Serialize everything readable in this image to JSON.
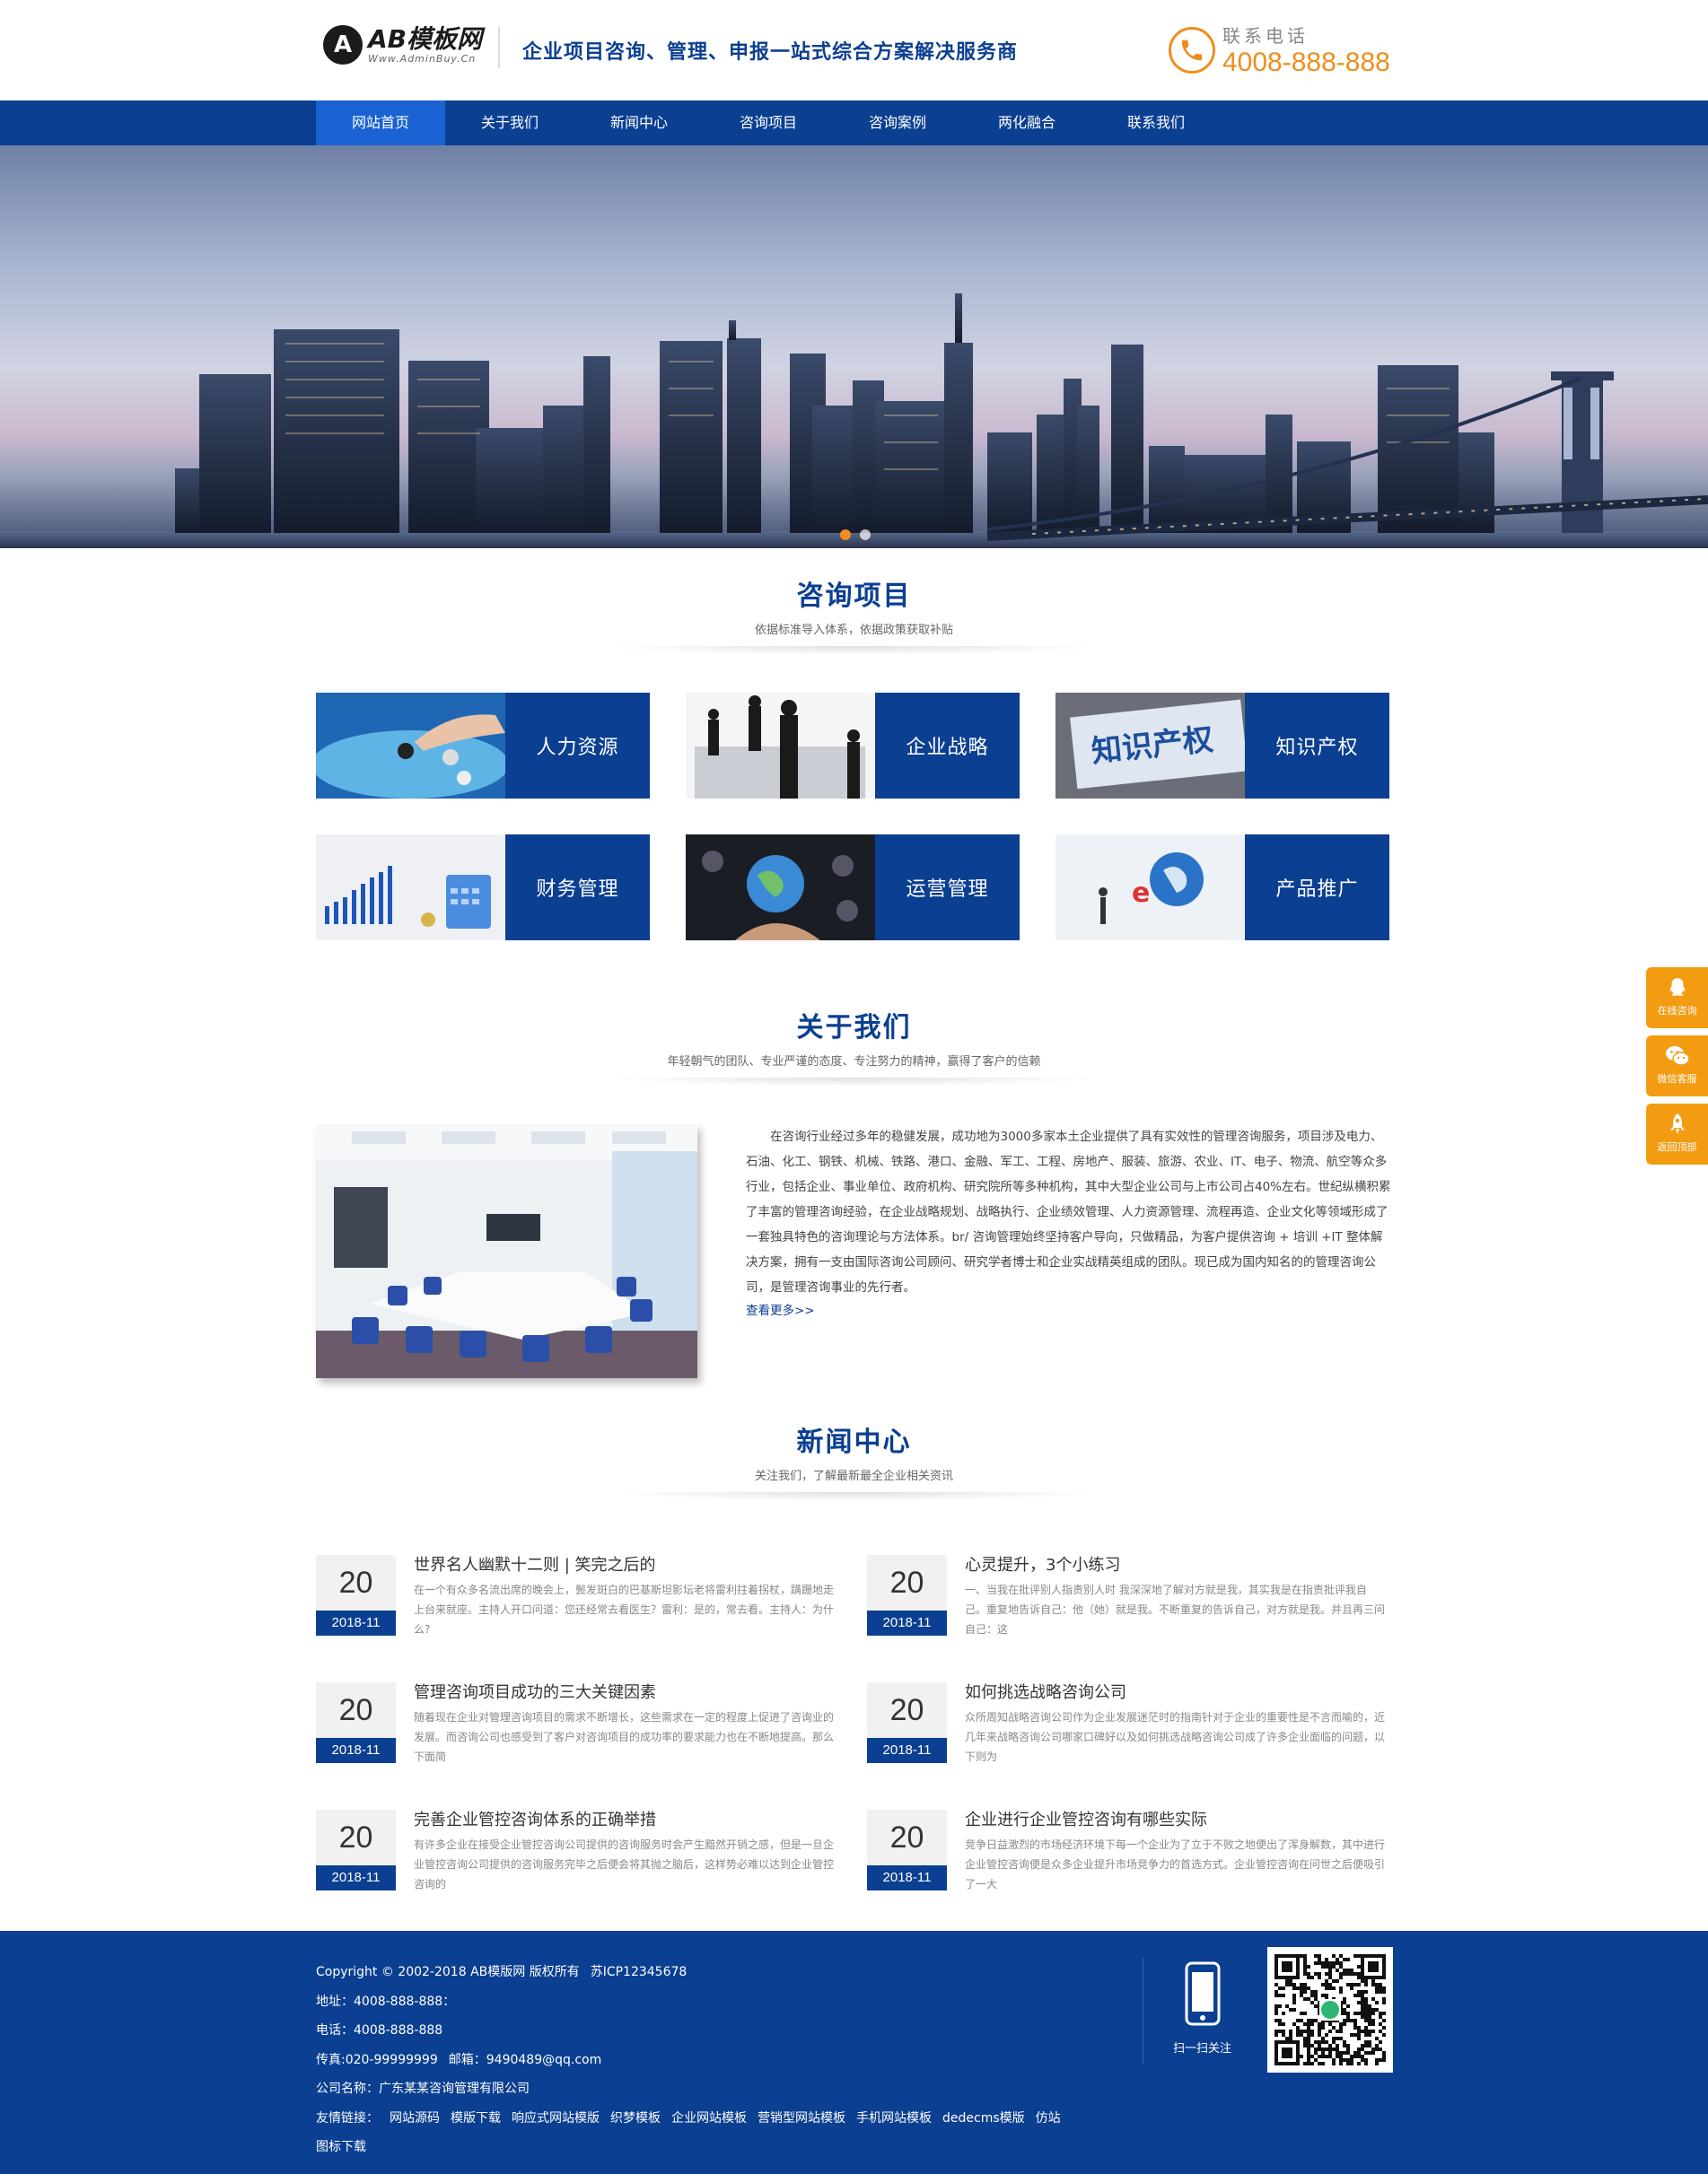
{
  "header": {
    "logo_mark": "A",
    "logo_name": "AB模板网",
    "logo_url": "Www.AdminBuy.Cn",
    "slogan": "企业项目咨询、管理、申报一站式综合方案解决服务商",
    "phone_label": "联系电话",
    "phone_number": "4008-888-888"
  },
  "nav": {
    "items": [
      "网站首页",
      "关于我们",
      "新闻中心",
      "咨询项目",
      "咨询案例",
      "两化融合",
      "联系我们"
    ],
    "active_index": 0
  },
  "services_section": {
    "title": "咨询项目",
    "subtitle": "依据标准导入体系，依据政策获取补贴",
    "items": [
      {
        "label": "人力资源"
      },
      {
        "label": "企业战略"
      },
      {
        "label": "知识产权"
      },
      {
        "label": "财务管理"
      },
      {
        "label": "运营管理"
      },
      {
        "label": "产品推广"
      }
    ]
  },
  "about_section": {
    "title": "关于我们",
    "subtitle": "年轻朝气的团队、专业严谨的态度、专注努力的精神，赢得了客户的信赖",
    "text": "在咨询行业经过多年的稳健发展，成功地为3000多家本土企业提供了具有实效性的管理咨询服务，项目涉及电力、石油、化工、钢铁、机械、铁路、港口、金融、军工、工程、房地产、服装、旅游、农业、IT、电子、物流、航空等众多行业，包括企业、事业单位、政府机构、研究院所等多种机构，其中大型企业公司与上市公司占40%左右。世纪纵横积累了丰富的管理咨询经验，在企业战略规划、战略执行、企业绩效管理、人力资源管理、流程再造、企业文化等领域形成了一套独具特色的咨询理论与方法体系。br/ 咨询管理始终坚持客户导向，只做精品，为客户提供咨询 + 培训 +IT 整体解决方案，拥有一支由国际咨询公司顾问、研究学者博士和企业实战精英组成的团队。现已成为国内知名的的管理咨询公司，是管理咨询事业的先行者。",
    "more": "查看更多>>"
  },
  "news_section": {
    "title": "新闻中心",
    "subtitle": "关注我们，了解最新最全企业相关资讯",
    "items": [
      {
        "day": "20",
        "month": "2018-11",
        "title": "世界名人幽默十二则 | 笑完之后的",
        "desc": "在一个有众多名流出席的晚会上，鬓发斑白的巴基斯坦影坛老将雷利拄着拐杖，蹒跚地走上台来就座。主持人开口问道：您还经常去看医生？雷利：是的，常去看。主持人：为什么?"
      },
      {
        "day": "20",
        "month": "2018-11",
        "title": "心灵提升，3个小练习",
        "desc": "一、当我在批评别人指责别人时 我深深地了解对方就是我，其实我是在指责批评我自己。重复地告诉自己：他（她）就是我。不断重复的告诉自己，对方就是我。并且再三问自己：这"
      },
      {
        "day": "20",
        "month": "2018-11",
        "title": "管理咨询项目成功的三大关键因素",
        "desc": "随着现在企业对管理咨询项目的需求不断增长，这些需求在一定的程度上促进了咨询业的发展。而咨询公司也感受到了客户对咨询项目的成功率的要求能力也在不断地提高。那么下面简"
      },
      {
        "day": "20",
        "month": "2018-11",
        "title": "如何挑选战略咨询公司",
        "desc": "众所周知战略咨询公司作为企业发展迷茫时的指南针对于企业的重要性是不言而喻的，近几年来战略咨询公司哪家口碑好以及如何挑选战略咨询公司成了许多企业面临的问题，以下则为"
      },
      {
        "day": "20",
        "month": "2018-11",
        "title": "完善企业管控咨询体系的正确举措",
        "desc": "有许多企业在接受企业管控咨询公司提供的咨询服务时会产生黯然开销之感，但是一旦企业管控咨询公司提供的咨询服务完毕之后便会将其抛之脑后，这样势必难以达到企业管控咨询的"
      },
      {
        "day": "20",
        "month": "2018-11",
        "title": "企业进行企业管控咨询有哪些实际",
        "desc": "竞争日益激烈的市场经济环境下每一个企业为了立于不败之地便出了浑身解数，其中进行企业管控咨询便是众多企业提升市场竞争力的首选方式。企业管控咨询在问世之后便吸引了一大"
      }
    ]
  },
  "footer": {
    "copyright": "Copyright © 2002-2018 AB模版网 版权所有",
    "icp": "苏ICP12345678",
    "address": "地址：4008-888-888：",
    "phone": "电话：4008-888-888",
    "fax": "传真:020-99999999",
    "email": "邮箱：9490489@qq.com",
    "company": "公司名称：广东某某咨询管理有限公司",
    "links_label": "友情链接：",
    "links": [
      "网站源码",
      "模版下载",
      "响应式网站模版",
      "织梦模板",
      "企业网站模板",
      "营销型网站模板",
      "手机网站模板",
      "dedecms模版",
      "仿站",
      "图标下载"
    ],
    "mobile_label": "扫一扫关注"
  },
  "float_bar": {
    "items": [
      "在线咨询",
      "微信客服",
      "返回顶部"
    ]
  },
  "colors": {
    "primary": "#0b3f91",
    "nav_active": "#1a62d1",
    "accent": "#f08d1e",
    "float": "#f39c12"
  }
}
